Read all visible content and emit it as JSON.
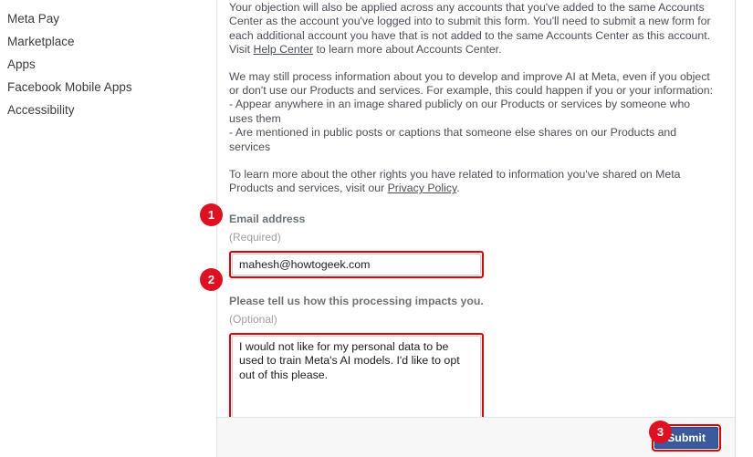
{
  "sidebar": {
    "items": [
      {
        "label": "Meta Pay"
      },
      {
        "label": "Marketplace"
      },
      {
        "label": "Apps"
      },
      {
        "label": "Facebook Mobile Apps"
      },
      {
        "label": "Accessibility"
      }
    ]
  },
  "content": {
    "paragraph_1": {
      "text_before_link": "Your objection will also be applied across any accounts that you've added to the same Accounts Center as the account you've logged into to submit this form. You'll need to submit a new form for each additional account you have that is not added to the same Accounts Center as this account. Visit ",
      "link_text": "Help Center",
      "text_after_link": " to learn more about Accounts Center."
    },
    "paragraph_2": {
      "intro": "We may still process information about you to develop and improve AI at Meta, even if you object or don't use our Products and services. For example, this could happen if you or your information:",
      "bullets": [
        "- Appear anywhere in an image shared publicly on our Products or services by someone who uses them",
        "- Are mentioned in public posts or captions that someone else shares on our Products and services"
      ]
    },
    "paragraph_3": {
      "text_before_link": "To learn more about the other rights you have related to information you've shared on Meta Products and services, visit our ",
      "link_text": "Privacy Policy",
      "text_after_link": "."
    }
  },
  "form": {
    "email": {
      "label": "Email address",
      "requirement": "(Required)",
      "value": "mahesh@howtogeek.com",
      "placeholder": ""
    },
    "comment": {
      "label": "Please tell us how this processing impacts you.",
      "requirement": "(Optional)",
      "value": "I would not like for my personal data to be used to train Meta's AI models. I'd like to opt out of this please.",
      "placeholder": ""
    },
    "submit_label": "Submit"
  },
  "annotations": {
    "badges": [
      {
        "number": "1"
      },
      {
        "number": "2"
      },
      {
        "number": "3"
      }
    ],
    "highlight_color": "#e60000",
    "badge_color": "#e01020"
  }
}
